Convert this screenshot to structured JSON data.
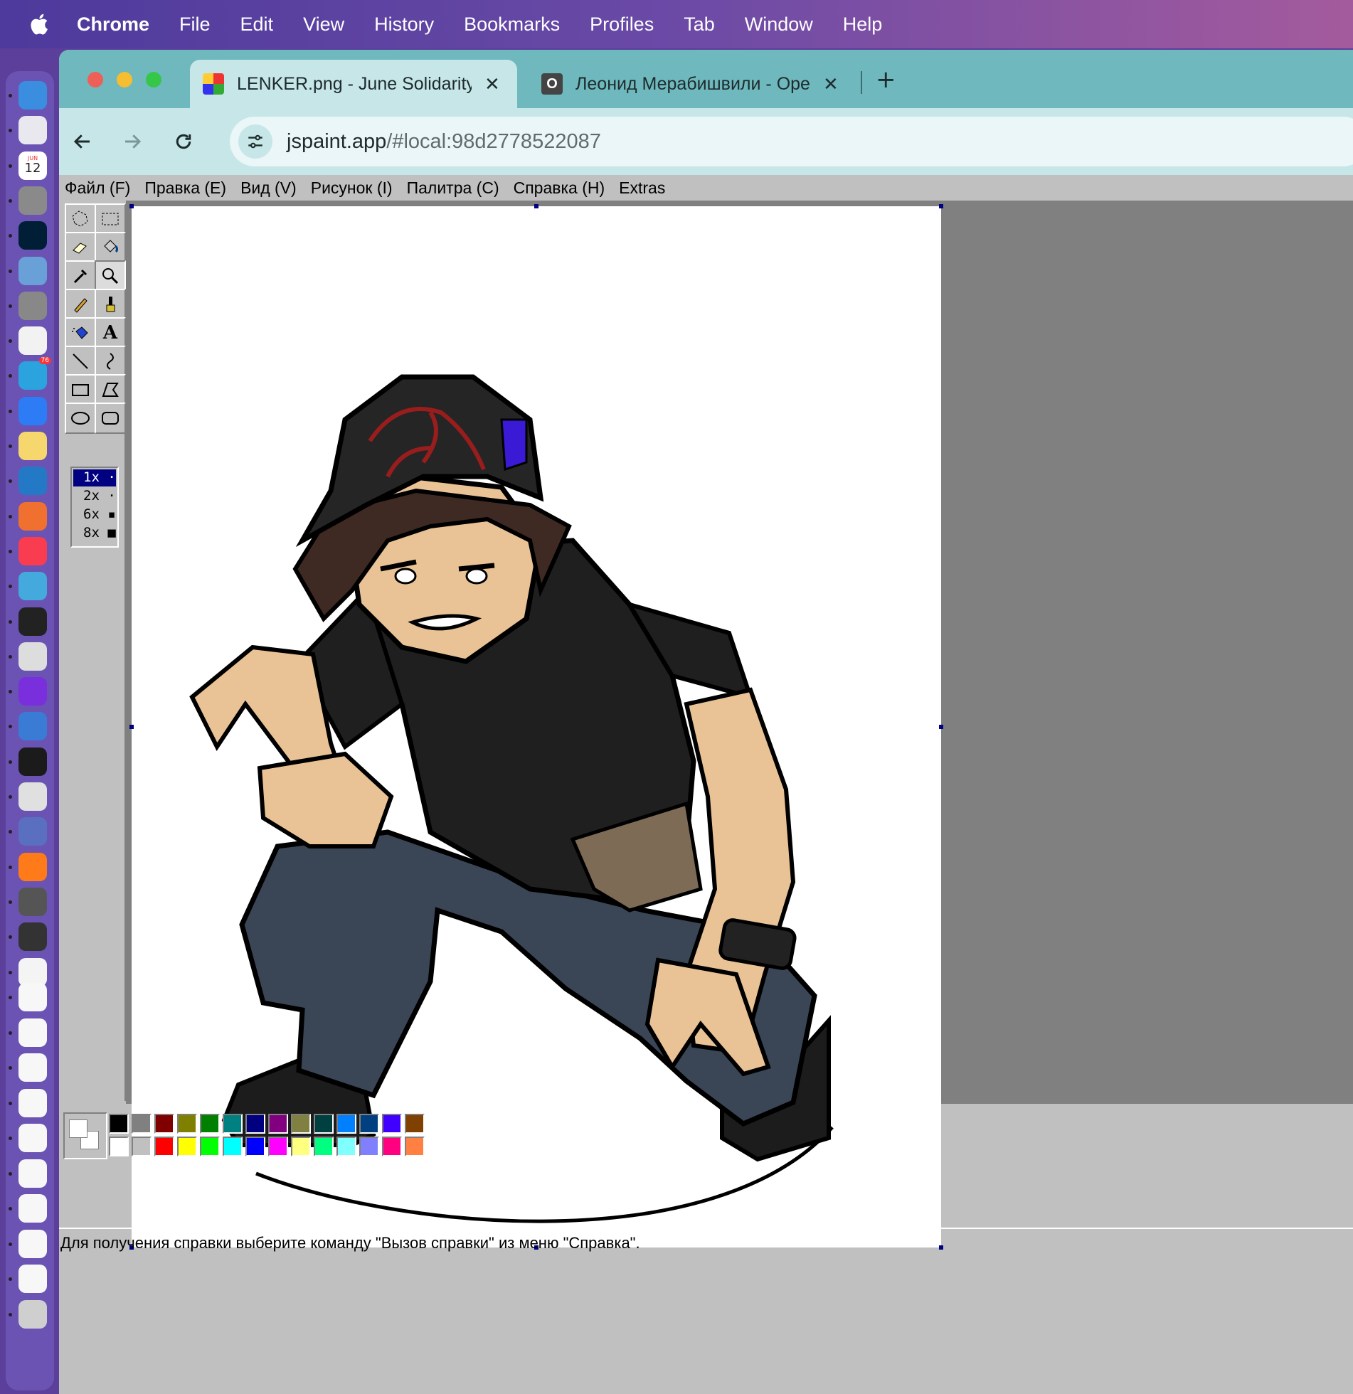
{
  "menubar": {
    "apple_icon": "apple-icon",
    "items": [
      "Chrome",
      "File",
      "Edit",
      "View",
      "History",
      "Bookmarks",
      "Profiles",
      "Tab",
      "Window",
      "Help"
    ]
  },
  "browser": {
    "tabs": [
      {
        "title": "LENKER.png - June Solidarity",
        "icon": "jspaint-icon",
        "active": true
      },
      {
        "title": "Леонид Мерабишвили - Ope",
        "icon": "opera-icon",
        "active": false
      }
    ],
    "new_tab_label": "+",
    "close_glyph": "✕",
    "url_host": "jspaint.app",
    "url_rest": "/#local:98d2778522087"
  },
  "jspaint": {
    "menu": [
      "Файл (F)",
      "Правка (E)",
      "Вид (V)",
      "Рисунок (I)",
      "Палитра (C)",
      "Справка (H)",
      "Extras"
    ],
    "tools": [
      "free-form-select",
      "rect-select",
      "eraser",
      "fill",
      "pick-color",
      "magnifier",
      "pencil",
      "brush",
      "airbrush",
      "text",
      "line",
      "curve",
      "rectangle",
      "polygon",
      "ellipse",
      "rounded-rectangle"
    ],
    "magnifier_selected": true,
    "zoom_options": [
      "1x",
      "2x",
      "6x",
      "8x"
    ],
    "zoom_selected": "1x",
    "primary_color": "#ffffff",
    "secondary_color": "#ffffff",
    "palette_top": [
      "#000000",
      "#808080",
      "#800000",
      "#808000",
      "#008000",
      "#008080",
      "#000080",
      "#800080",
      "#808040",
      "#004040",
      "#0080ff",
      "#004080",
      "#4000ff",
      "#804000"
    ],
    "palette_bottom": [
      "#ffffff",
      "#c0c0c0",
      "#ff0000",
      "#ffff00",
      "#00ff00",
      "#00ffff",
      "#0000ff",
      "#ff00ff",
      "#ffff80",
      "#00ff80",
      "#80ffff",
      "#8080ff",
      "#ff0080",
      "#ff8040"
    ],
    "status": "Для получения справки выберите команду \"Вызов справки\" из меню \"Справка\"."
  },
  "dock": {
    "apps": [
      "finder",
      "launchpad",
      "calendar",
      "system-settings",
      "photoshop",
      "preview",
      "iphone-mirroring",
      "chrome",
      "telegram",
      "safari",
      "notes",
      "vscode",
      "pencil-app",
      "music",
      "quicktime",
      "xp-pen",
      "textedit",
      "capture-one",
      "audio-app",
      "terminal",
      "stethoscope-app",
      "toolbox-app",
      "firefox",
      "calculator",
      "screenshot-app",
      "lenker-preview",
      "doc-1",
      "doc-2",
      "doc-3",
      "doc-4",
      "doc-5",
      "doc-6",
      "doc-7",
      "doc-8",
      "doc-9",
      "trash"
    ],
    "calendar_date": "12",
    "calendar_month": "JUN",
    "telegram_badge": "76"
  }
}
